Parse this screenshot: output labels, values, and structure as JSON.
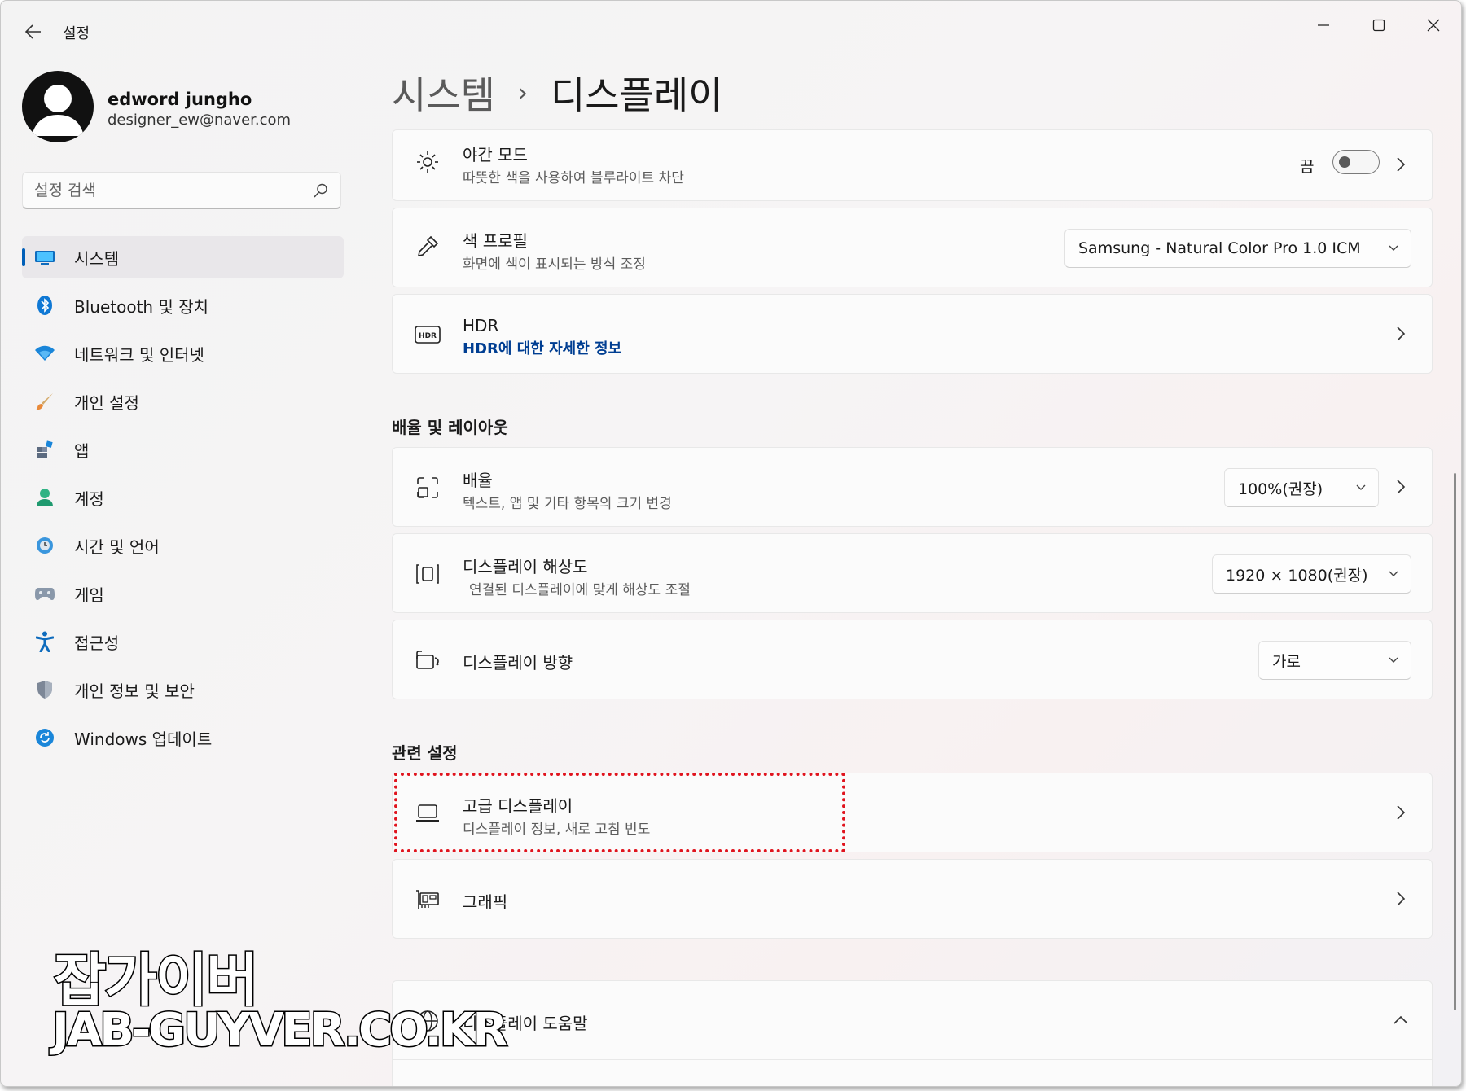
{
  "window": {
    "title": "설정",
    "accent_color": "#005fb8"
  },
  "profile": {
    "name": "edword jungho",
    "email": "designer_ew@naver.com"
  },
  "search": {
    "placeholder": "설정 검색",
    "icon": "search-icon"
  },
  "sidebar": {
    "items": [
      {
        "label": "시스템",
        "icon": "monitor-icon",
        "active": true
      },
      {
        "label": "Bluetooth 및 장치",
        "icon": "bluetooth-icon"
      },
      {
        "label": "네트워크 및 인터넷",
        "icon": "wifi-icon"
      },
      {
        "label": "개인 설정",
        "icon": "brush-icon"
      },
      {
        "label": "앱",
        "icon": "apps-icon"
      },
      {
        "label": "계정",
        "icon": "person-icon"
      },
      {
        "label": "시간 및 언어",
        "icon": "globe-clock-icon"
      },
      {
        "label": "게임",
        "icon": "gamepad-icon"
      },
      {
        "label": "접근성",
        "icon": "accessibility-icon"
      },
      {
        "label": "개인 정보 및 보안",
        "icon": "shield-icon"
      },
      {
        "label": "Windows 업데이트",
        "icon": "update-icon"
      }
    ]
  },
  "breadcrumb": {
    "parent": "시스템",
    "separator": "›",
    "current": "디스플레이"
  },
  "cards": {
    "night_mode": {
      "title": "야간 모드",
      "subtitle": "따뜻한 색을 사용하여 블루라이트 차단",
      "toggle_label": "끔",
      "toggle_on": false
    },
    "color_profile": {
      "title": "색 프로필",
      "subtitle": "화면에 색이 표시되는 방식 조정",
      "value": "Samsung - Natural Color Pro 1.0 ICM"
    },
    "hdr": {
      "title": "HDR",
      "link": "HDR에 대한 자세한 정보",
      "icon_text": "HDR"
    },
    "scale": {
      "title": "배율",
      "subtitle": "텍스트, 앱 및 기타 항목의 크기 변경",
      "value": "100%(권장)"
    },
    "resolution": {
      "title": "디스플레이 해상도",
      "subtitle": "연결된 디스플레이에 맞게 해상도 조절",
      "value": "1920 × 1080(권장)"
    },
    "orientation": {
      "title": "디스플레이 방향",
      "value": "가로"
    },
    "advanced_display": {
      "title": "고급 디스플레이",
      "subtitle": "디스플레이 정보, 새로 고침 빈도"
    },
    "graphics": {
      "title": "그래픽"
    },
    "display_help": {
      "title": "디스플레이 도움말"
    }
  },
  "sections": {
    "scale_layout": "배율 및 레이아웃",
    "related": "관련 설정"
  },
  "watermark": {
    "line1": "잡가이버",
    "line2": "JAB-GUYVER.CO.KR"
  }
}
